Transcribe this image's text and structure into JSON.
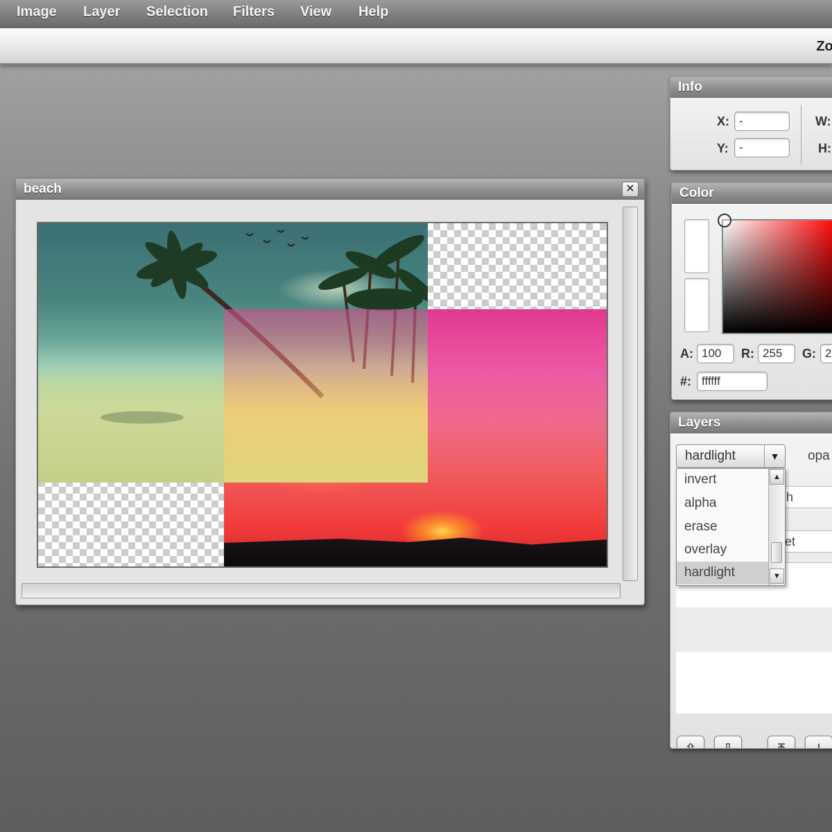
{
  "menu": {
    "items": [
      "Image",
      "Layer",
      "Selection",
      "Filters",
      "View",
      "Help"
    ]
  },
  "toolbar": {
    "zoom_label": "Zoo"
  },
  "document": {
    "title": "beach",
    "close_label": "✕"
  },
  "info_panel": {
    "title": "Info",
    "x_label": "X:",
    "x_value": "-",
    "y_label": "Y:",
    "y_value": "-",
    "w_label": "W:",
    "h_label": "H:"
  },
  "color_panel": {
    "title": "Color",
    "a_label": "A:",
    "a_value": "100",
    "r_label": "R:",
    "r_value": "255",
    "g_label": "G:",
    "g_value": "2",
    "hex_label": "#:",
    "hex_value": "ffffff"
  },
  "layers_panel": {
    "title": "Layers",
    "blend_mode": "hardlight",
    "opacity_label": "opa",
    "blend_options": [
      "invert",
      "alpha",
      "erase",
      "overlay",
      "hardlight"
    ],
    "row1_partial": "h",
    "row2_partial": "et",
    "buttons": {
      "move_up": "⇧",
      "move_down": "⇩",
      "move_top": "⤒",
      "move_bottom": "⤓"
    }
  },
  "colors": {
    "accent_red": "#ff0000",
    "panel_bg": "#dcdcdc",
    "titlebar": "#8f8f8f"
  }
}
